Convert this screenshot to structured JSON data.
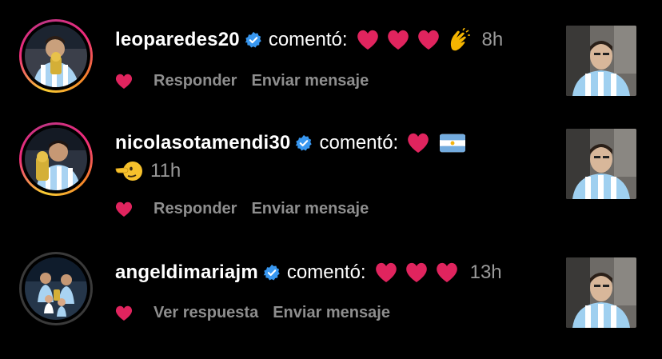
{
  "comments": [
    {
      "username": "leoparedes20",
      "verified": true,
      "action": "comentó:",
      "emojis": [
        "heart",
        "heart",
        "heart",
        "clap"
      ],
      "time": "8h",
      "reply_label": "Responder",
      "message_label": "Enviar mensaje",
      "ring": "gradient"
    },
    {
      "username": "nicolasotamendi30",
      "verified": true,
      "action": "comentó:",
      "emojis": [
        "heart",
        "argentina-flag"
      ],
      "second_line_emojis": [
        "pointing-face"
      ],
      "time": "11h",
      "reply_label": "Responder",
      "message_label": "Enviar mensaje",
      "ring": "gradient"
    },
    {
      "username": "angeldimariajm",
      "verified": true,
      "action": "comentó:",
      "emojis": [
        "heart",
        "heart",
        "heart"
      ],
      "time": "13h",
      "reply_label": "Ver respuesta",
      "message_label": "Enviar mensaje",
      "ring": "plain"
    }
  ],
  "colors": {
    "background": "#000000",
    "heart": "#e0245e",
    "verified_badge": "#3897f0",
    "secondary_text": "#8e8e8e",
    "time_text": "#9a9a9a"
  }
}
